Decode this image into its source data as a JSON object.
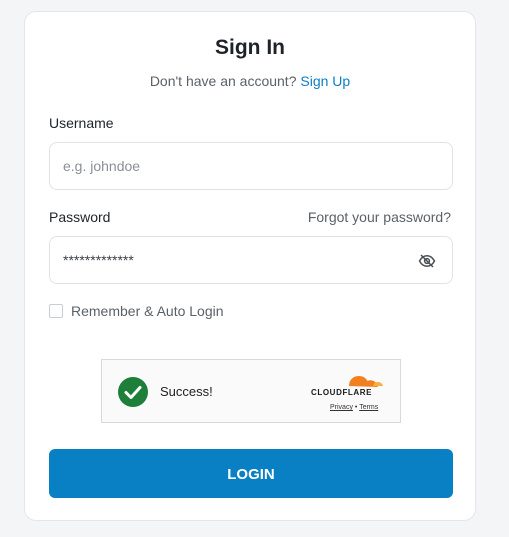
{
  "header": {
    "title": "Sign In",
    "subtitle_prefix": "Don't have an account?",
    "signup_link": "Sign Up"
  },
  "form": {
    "username_label": "Username",
    "username_placeholder": "e.g. johndoe",
    "password_label": "Password",
    "forgot_link": "Forgot your password?",
    "password_value": "*************",
    "eye_icon": "eye-off-icon",
    "remember_label": "Remember & Auto Login",
    "remember_checked": false
  },
  "captcha": {
    "status_text": "Success!",
    "provider": "CLOUDFLARE",
    "privacy_link": "Privacy",
    "separator": "•",
    "terms_link": "Terms",
    "success_color": "#1d7f3a",
    "brand_color": "#f38020"
  },
  "actions": {
    "login_label": "LOGIN"
  },
  "colors": {
    "accent": "#0980c3",
    "link": "#0b7fc4"
  }
}
